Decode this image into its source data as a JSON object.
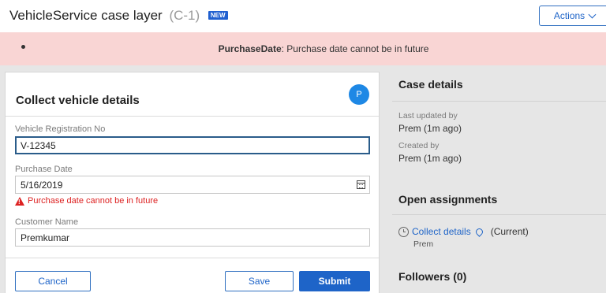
{
  "header": {
    "title": "VehicleService case layer",
    "case_id": "(C-1)",
    "badge": "NEW",
    "actions_label": "Actions"
  },
  "banner": {
    "field": "PurchaseDate",
    "message": ": Purchase date cannot be in future"
  },
  "form": {
    "title": "Collect vehicle details",
    "avatar_initial": "P",
    "fields": [
      {
        "label": "Vehicle Registration No",
        "value": "V-12345"
      },
      {
        "label": "Purchase Date",
        "value": "5/16/2019",
        "error": "Purchase date cannot be in future"
      },
      {
        "label": "Customer Name",
        "value": "Premkumar"
      }
    ],
    "buttons": {
      "cancel": "Cancel",
      "save": "Save",
      "submit": "Submit"
    }
  },
  "case_details": {
    "title": "Case details",
    "last_updated_label": "Last updated by",
    "last_updated_value": "Prem (1m ago)",
    "created_label": "Created by",
    "created_value": "Prem (1m ago)"
  },
  "assignments": {
    "title": "Open assignments",
    "item_link": "Collect details",
    "item_status": "(Current)",
    "item_assignee": "Prem"
  },
  "followers": {
    "title": "Followers (0)"
  },
  "colors": {
    "accent": "#1e64c8",
    "error": "#d22222",
    "banner_bg": "#f9d5d4",
    "avatar": "#1e88e5"
  }
}
